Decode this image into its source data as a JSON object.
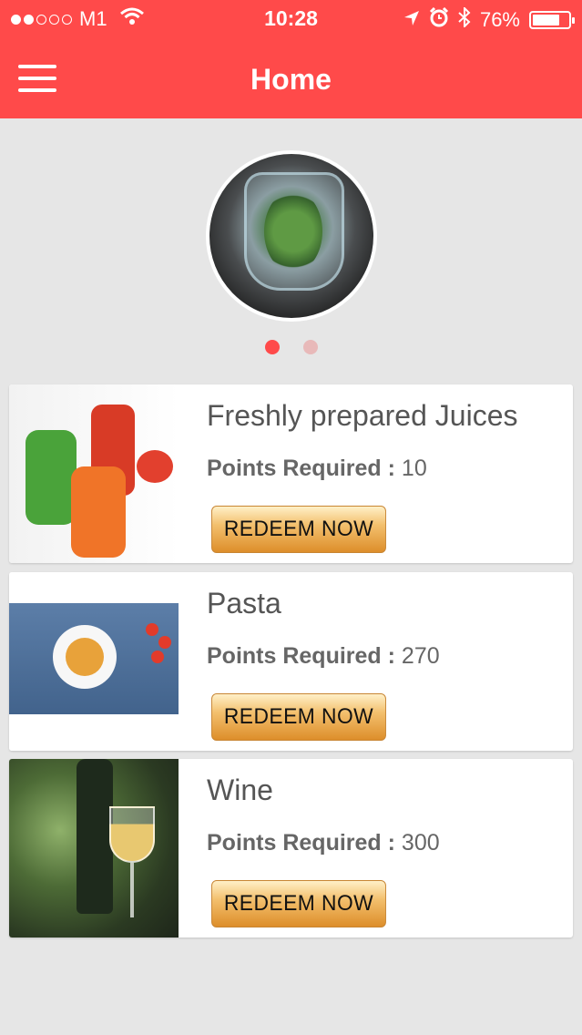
{
  "status_bar": {
    "carrier": "M1",
    "time": "10:28",
    "battery": "76%",
    "battery_level": 0.76
  },
  "nav": {
    "title": "Home"
  },
  "carousel": {
    "page_count": 2,
    "active_index": 0
  },
  "rewards": [
    {
      "title": "Freshly prepared Juices",
      "points_label": "Points Required :",
      "points": "10",
      "button": "REDEEM NOW"
    },
    {
      "title": "Pasta",
      "points_label": "Points Required :",
      "points": "270",
      "button": "REDEEM NOW"
    },
    {
      "title": "Wine",
      "points_label": "Points Required :",
      "points": "300",
      "button": "REDEEM NOW"
    }
  ],
  "colors": {
    "header": "#ff4a4a",
    "background": "#e6e6e6",
    "active_dot": "#ff4a4a",
    "inactive_dot": "#e8b9b9"
  }
}
